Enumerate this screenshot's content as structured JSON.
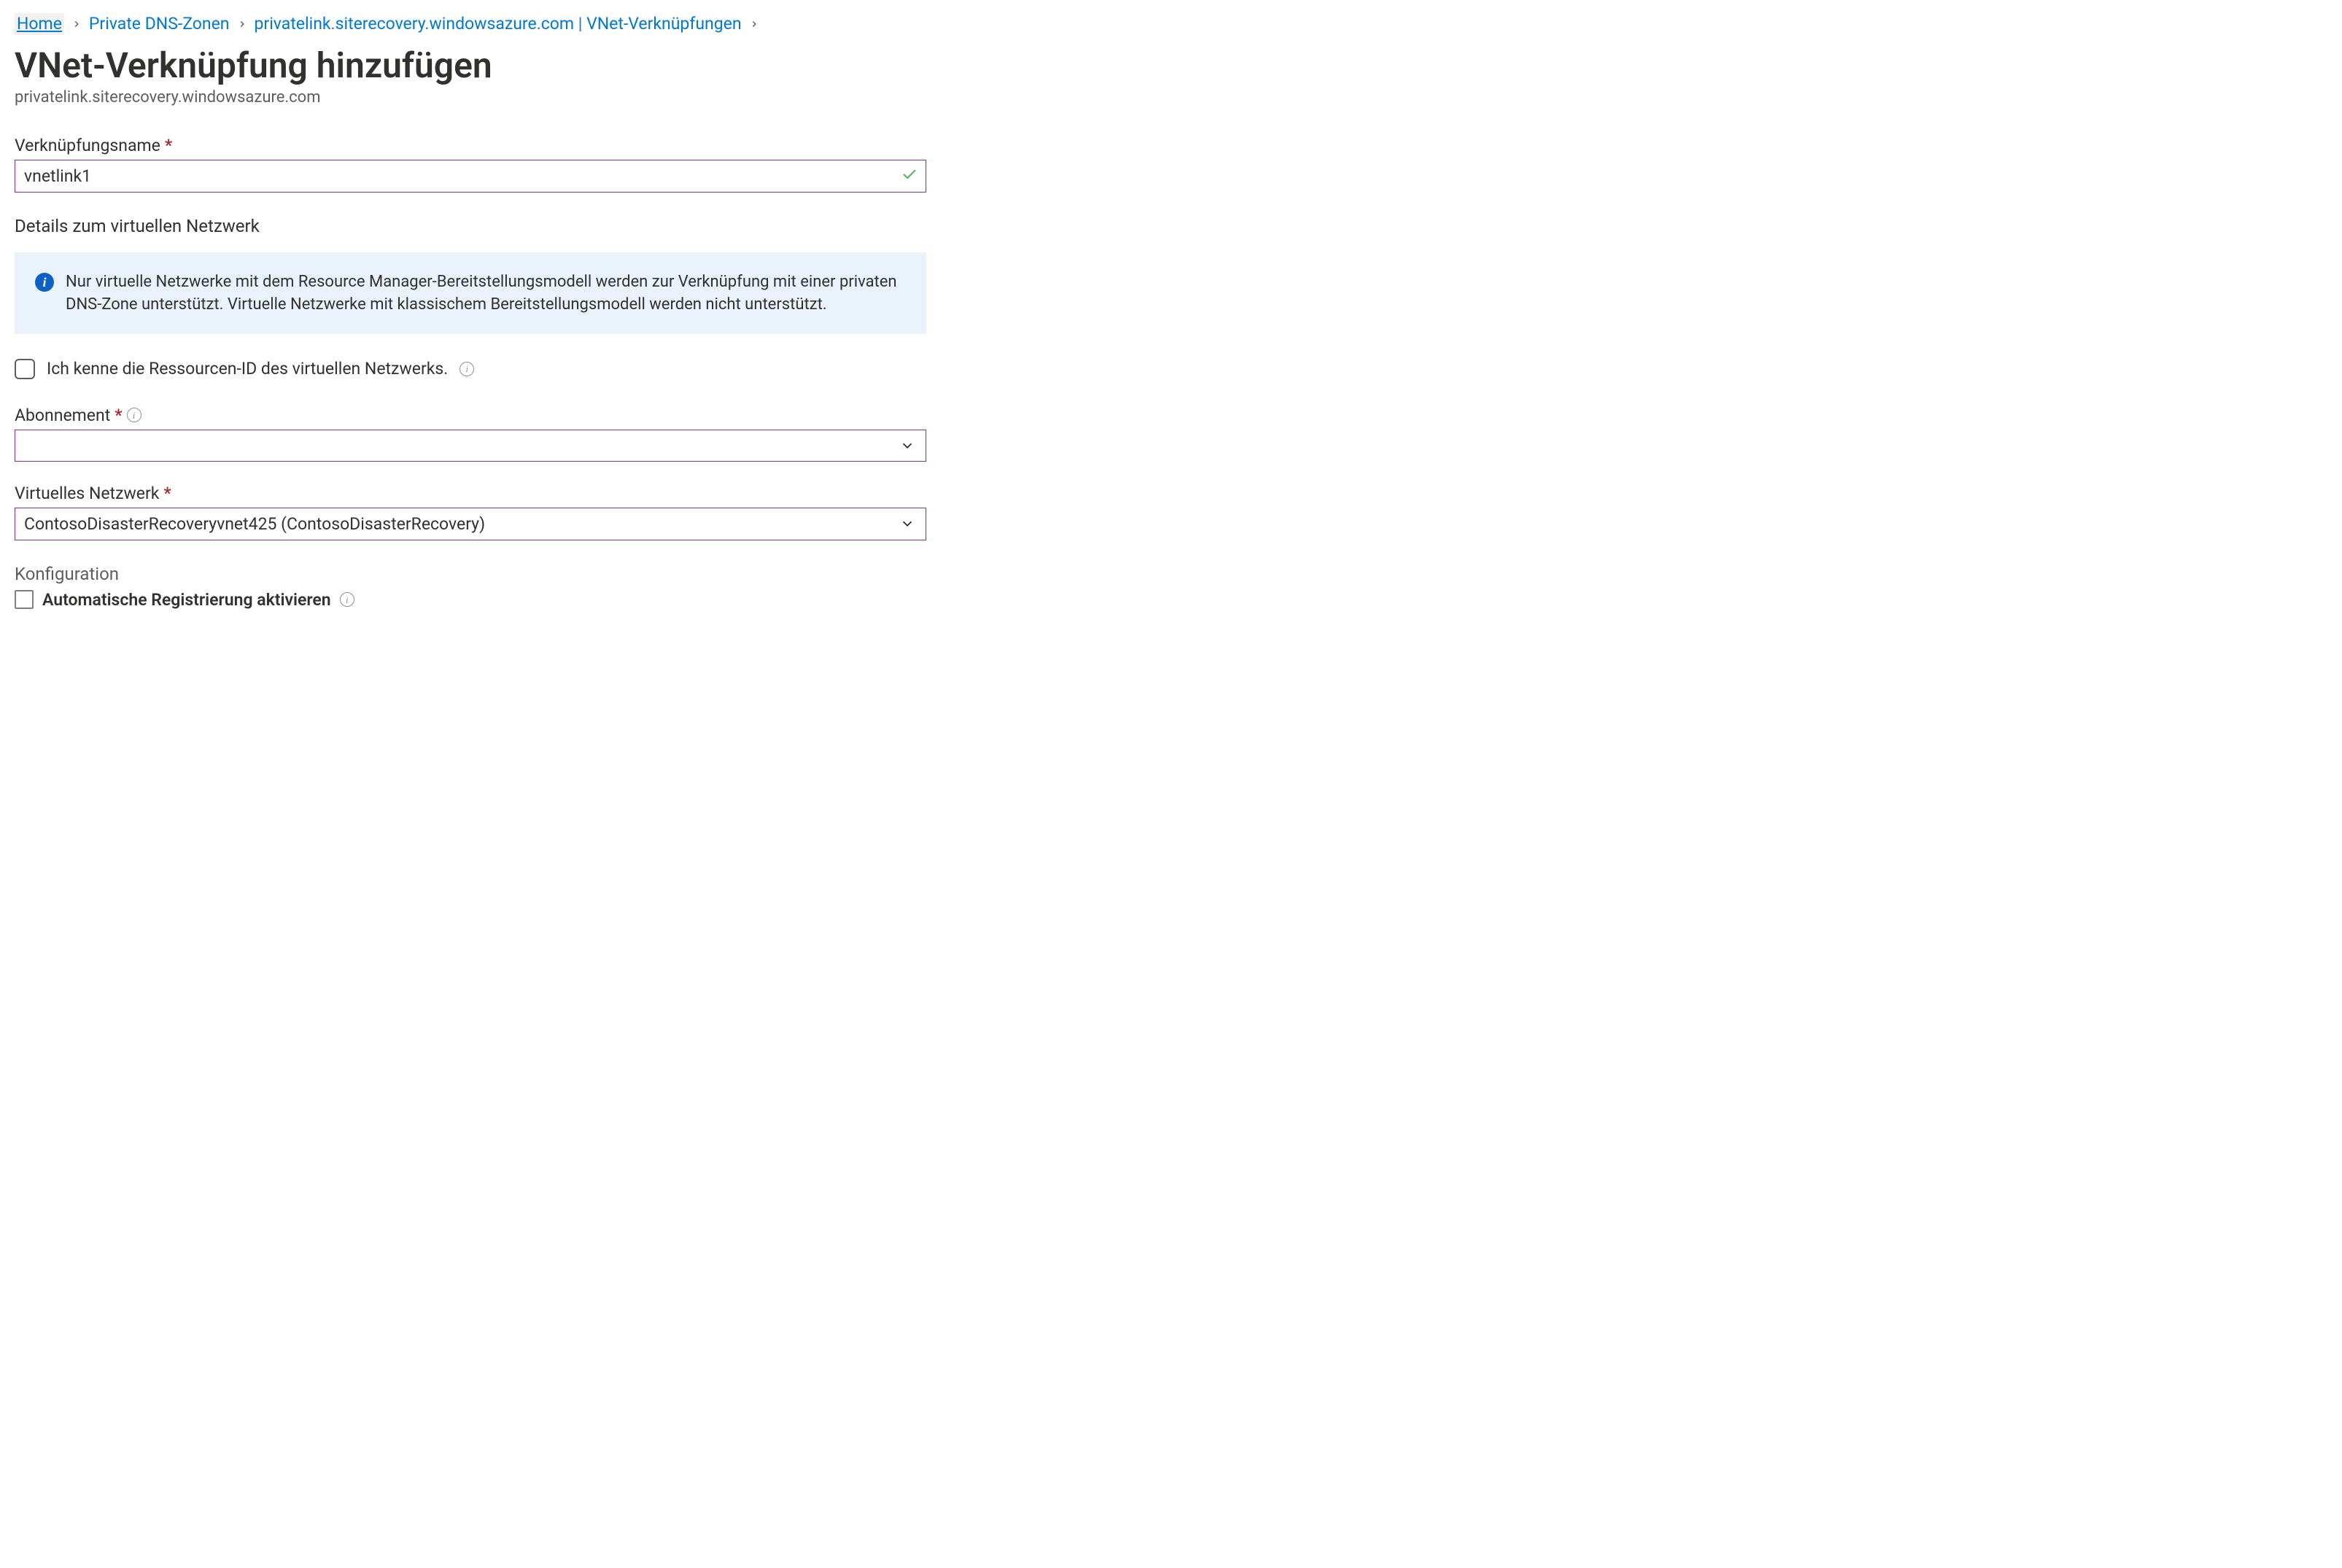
{
  "breadcrumb": {
    "items": [
      {
        "label": "Home"
      },
      {
        "label": "Private DNS-Zonen"
      },
      {
        "label": "privatelink.siterecovery.windowsazure.com | VNet-Verknüpfungen"
      }
    ]
  },
  "page": {
    "title": "VNet-Verknüpfung hinzufügen",
    "subtitle": "privatelink.siterecovery.windowsazure.com"
  },
  "form": {
    "link_name_label": "Verknüpfungsname",
    "link_name_value": "vnetlink1",
    "vnet_details_heading": "Details zum virtuellen Netzwerk",
    "info_message": "Nur virtuelle Netzwerke mit dem Resource Manager-Bereitstellungsmodell werden zur Verknüpfung mit einer privaten DNS-Zone unterstützt. Virtuelle Netzwerke mit klassischem Bereitstellungsmodell werden nicht unterstützt.",
    "know_resource_id_label": "Ich kenne die Ressourcen-ID des virtuellen Netzwerks.",
    "subscription_label": "Abonnement",
    "subscription_value": "",
    "vnet_label": "Virtuelles Netzwerk",
    "vnet_value": "ContosoDisasterRecoveryvnet425 (ContosoDisasterRecovery)",
    "config_heading": "Konfiguration",
    "auto_reg_label": "Automatische Registrierung aktivieren"
  }
}
